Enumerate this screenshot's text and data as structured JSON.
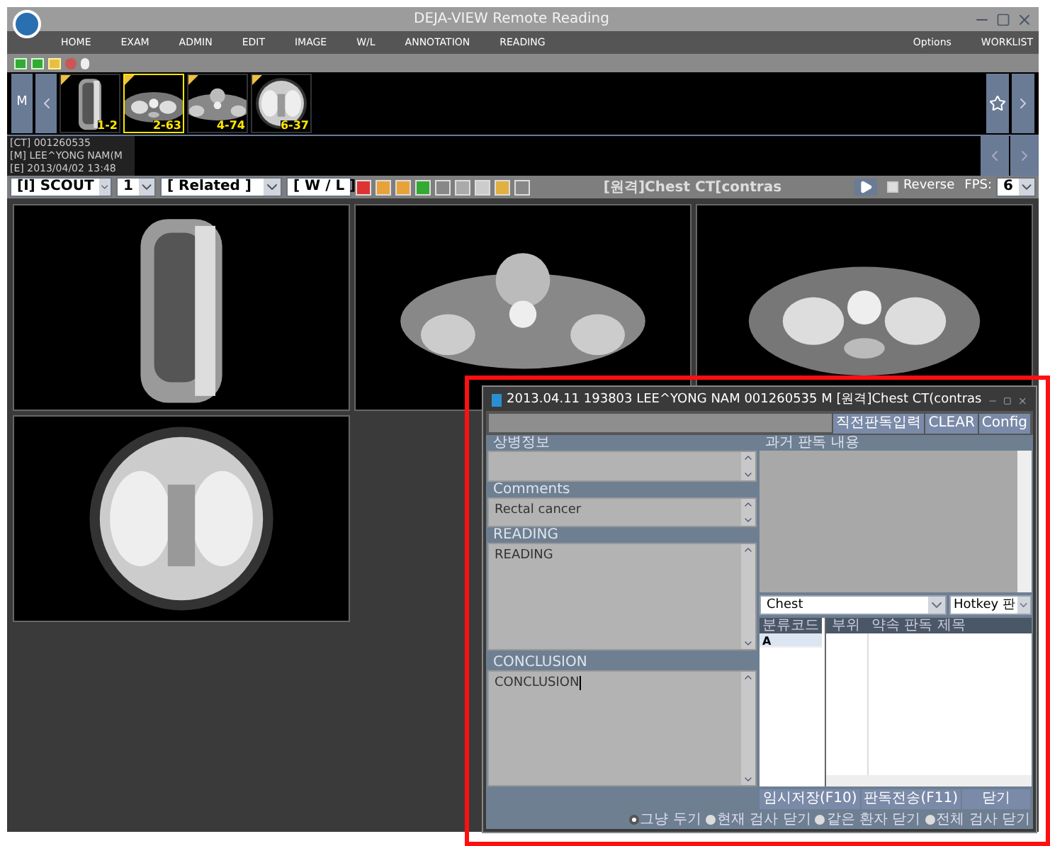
{
  "window": {
    "title": "DEJA-VIEW Remote Reading"
  },
  "menu": [
    {
      "label": "HOME"
    },
    {
      "label": "EXAM"
    },
    {
      "label": "ADMIN"
    },
    {
      "label": "EDIT"
    },
    {
      "label": "IMAGE"
    },
    {
      "label": "W/L"
    },
    {
      "label": "ANNOTATION"
    },
    {
      "label": "READING"
    }
  ],
  "options_menu": "Options",
  "worklist": "WORKLIST",
  "strip_mode": "M",
  "thumbnails": [
    {
      "label": "1-2",
      "selected": false
    },
    {
      "label": "2-63",
      "selected": true
    },
    {
      "label": "4-74",
      "selected": false
    },
    {
      "label": "6-37",
      "selected": false
    }
  ],
  "patient_info": [
    "[CT] 001260535",
    "[M] LEE^YONG NAM(M",
    "[E] 2013/04/02 13:48"
  ],
  "series_bar": {
    "series": "[I] SCOUT",
    "index": "1",
    "related": "[ Related ]",
    "wl": "[ W / L ]",
    "title": "[원격]Chest CT[contras",
    "reverse": {
      "label": "Reverse",
      "checked": false
    },
    "fps_label": "FPS:",
    "fps": "6"
  },
  "dialog": {
    "title": "2013.04.11 193803 LEE^YONG NAM 001260535  M [원격]Chest CT(contras",
    "buttons": [
      {
        "label": "직전판독입력"
      },
      {
        "label": "CLEAR"
      },
      {
        "label": "Config"
      }
    ],
    "diagnosis": {
      "header": "상병정보"
    },
    "comments": {
      "header": "Comments",
      "value": "Rectal cancer"
    },
    "reading": {
      "header": "READING",
      "value": "READING"
    },
    "conclusion": {
      "header": "CONCLUSION",
      "value": "CONCLUSION"
    },
    "history": {
      "header": "과거 판독 내용"
    },
    "category": "Chest",
    "hotkey": "Hotkey 판",
    "table": {
      "columns": [
        "분류코드",
        "부위",
        "약속 판독 제목"
      ],
      "codes": [
        {
          "code": "A",
          "selected": true
        }
      ]
    },
    "actions": [
      {
        "label": "임시저장(F10)"
      },
      {
        "label": "판독전송(F11)"
      },
      {
        "label": "닫기"
      }
    ],
    "close_options": [
      {
        "label": "그냥 두기",
        "selected": true
      },
      {
        "label": "현재 검사 닫기",
        "selected": false
      },
      {
        "label": "같은 환자 닫기",
        "selected": false
      },
      {
        "label": "전체 검사 닫기",
        "selected": false
      }
    ]
  }
}
